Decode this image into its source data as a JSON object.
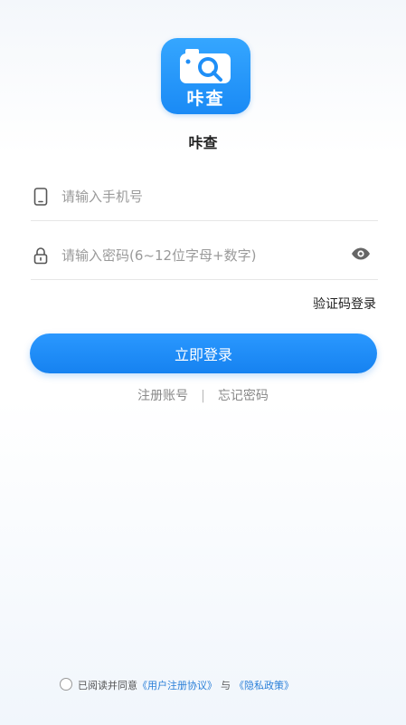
{
  "app": {
    "logo_text": "咔查",
    "name": "咔查"
  },
  "login_form": {
    "phone_placeholder": "请输入手机号",
    "password_placeholder": "请输入密码(6~12位字母+数字)",
    "sms_login_label": "验证码登录",
    "login_button_label": "立即登录",
    "register_label": "注册账号",
    "separator": "|",
    "forgot_password_label": "忘记密码"
  },
  "agreement": {
    "prefix": "已阅读并同意",
    "user_agreement": "《用户注册协议》",
    "conjunction": "与",
    "privacy_policy": "《隐私政策》"
  },
  "colors": {
    "accent": "#1a8af5",
    "link": "#2a7fd8"
  }
}
